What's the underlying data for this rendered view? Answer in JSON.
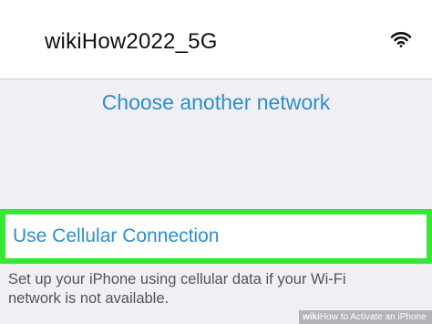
{
  "network": {
    "name": "wikiHow2022_5G",
    "signal_icon": "wifi-icon"
  },
  "choose_network_label": "Choose another network",
  "cellular": {
    "label": "Use Cellular Connection",
    "description": "Set up your iPhone using cellular data if your Wi-Fi network is not available.",
    "highlight_color": "#35e832"
  },
  "watermark": {
    "brand": "wiki",
    "title": "How to Activate an iPhone"
  },
  "colors": {
    "link_blue": "#2f8fce",
    "background": "#efeff4"
  }
}
